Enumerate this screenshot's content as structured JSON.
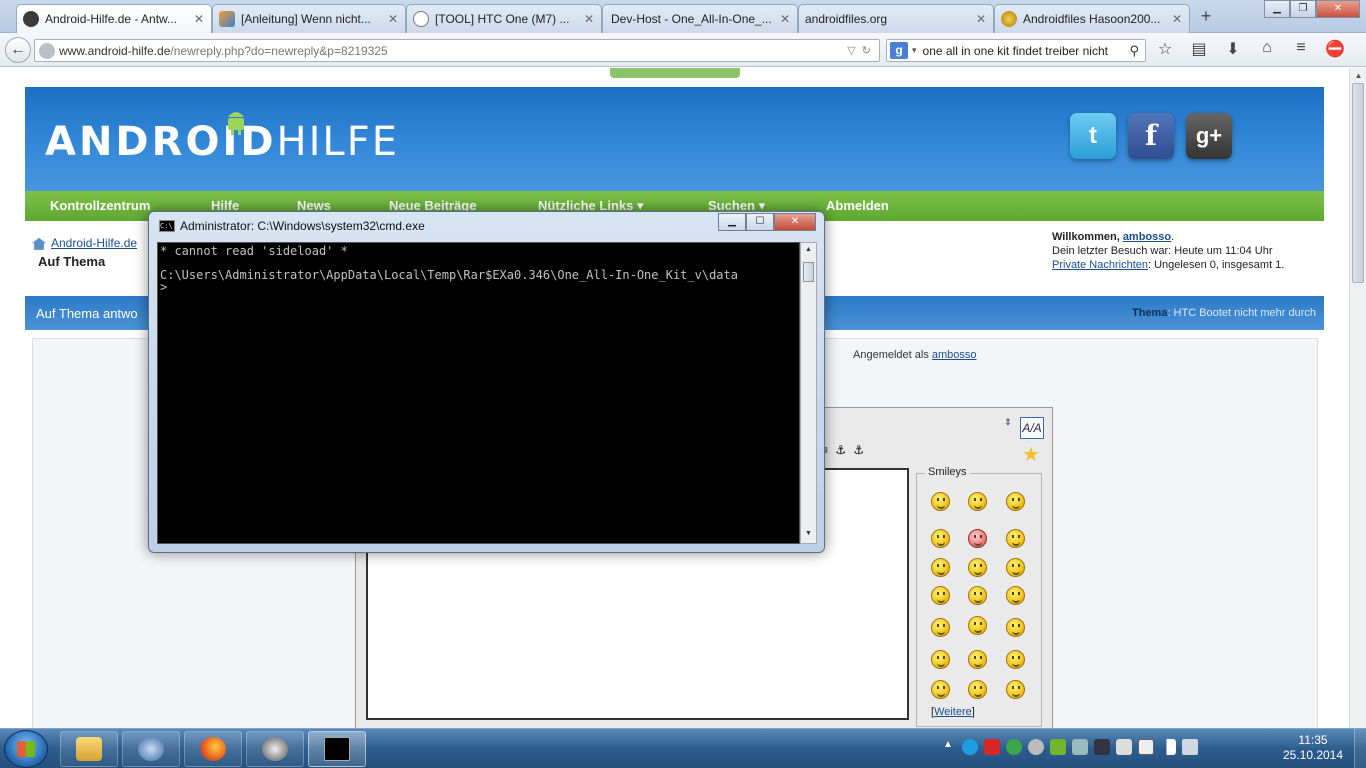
{
  "browser": {
    "tabs": [
      {
        "label": "Android-Hilfe.de - Antw...",
        "active": true,
        "favicon": "android-icon"
      },
      {
        "label": "[Anleitung] Wenn nicht...",
        "active": false,
        "favicon": "hilfe-icon"
      },
      {
        "label": "[TOOL] HTC One (M7) ...",
        "active": false,
        "favicon": "globe-icon"
      },
      {
        "label": "Dev-Host - One_All-In-One_...",
        "active": false,
        "favicon": "devhost-icon"
      },
      {
        "label": "androidfiles.org",
        "active": false,
        "favicon": "blank-icon"
      },
      {
        "label": "Androidfiles Hasoon200...",
        "active": false,
        "favicon": "bee-icon"
      }
    ],
    "new_tab_glyph": "+",
    "url_host": "www.android-hilfe.de",
    "url_path": "/newreply.php?do=newreply&p=8219325",
    "search_engine": "g",
    "search_query": "one all in one kit findet treiber nicht"
  },
  "site": {
    "logo_text": "ANDROID",
    "logo_suffix": "HILFE",
    "social": {
      "twitter": "t",
      "facebook": "f",
      "googleplus": "g+"
    },
    "menu": [
      "Kontrollzentrum",
      "Hilfe",
      "News",
      "Neue Beiträge",
      "Nützliche Links ▾",
      "Suchen ▾",
      "Abmelden"
    ],
    "breadcrumb_home": "Android-Hilfe.de",
    "breadcrumb_sub": "Auf Thema",
    "welcome": {
      "greeting": "Willkommen,",
      "user": "ambosso",
      "dot": ".",
      "last_visit": "Dein letzter Besuch war: Heute um 11:04 Uhr",
      "pm_link": "Private Nachrichten",
      "pm_status": ": Ungelesen 0, insgesamt 1."
    },
    "form_title": "Auf Thema antwo",
    "thema_label": "Thema",
    "thema_value": ": HTC Bootet nicht mehr durch",
    "logged_in_prefix": "Angemeldet als",
    "logged_in_user": "ambosso",
    "toolbar_glyphs": "≡ ⚓ ⚓",
    "sizer_glyph": "⇕",
    "font_toggle": "A/A",
    "smileys_legend": "Smileys",
    "weitere_open": "[",
    "weitere_link": "Weitere",
    "weitere_close": "]"
  },
  "cmd": {
    "title": "Administrator: C:\\Windows\\system32\\cmd.exe",
    "lines": [
      "* cannot read 'sideload' *",
      "",
      "C:\\Users\\Administrator\\AppData\\Local\\Temp\\Rar$EXa0.346\\One_All-In-One_Kit_v\\data",
      ">"
    ]
  },
  "taskbar": {
    "time": "11:35",
    "date": "25.10.2014"
  }
}
